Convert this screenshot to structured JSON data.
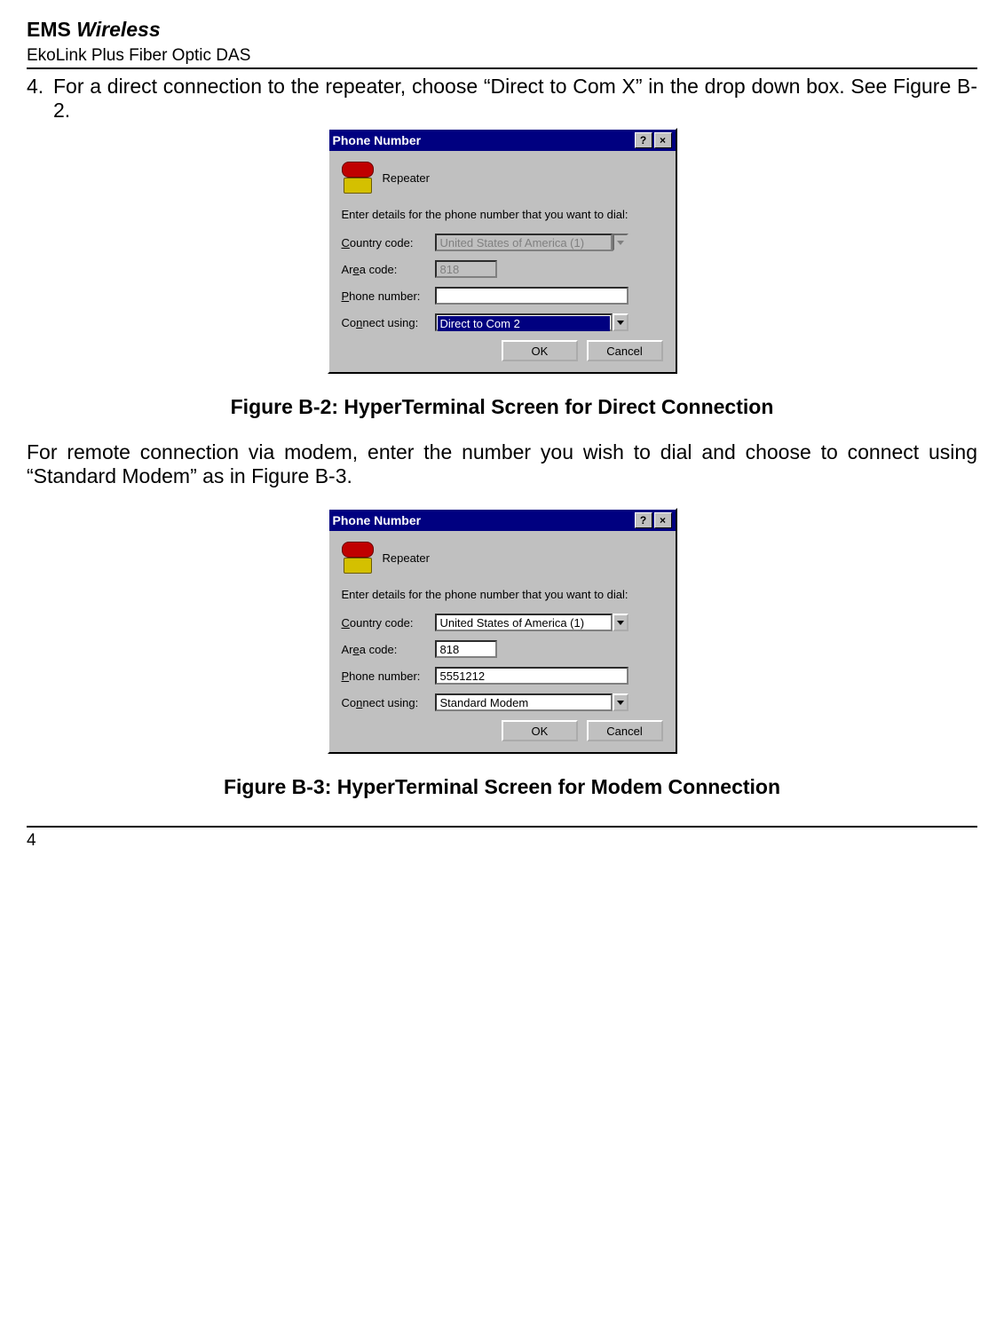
{
  "header": {
    "brand_prefix": "EMS ",
    "brand_italic": "Wireless",
    "product": "EkoLink Plus Fiber Optic DAS"
  },
  "step4": {
    "num": "4.",
    "text": "For a direct connection to the repeater, choose “Direct to Com X” in the drop down box. See Figure B-2."
  },
  "dlg1": {
    "title": "Phone Number",
    "help_glyph": "?",
    "close_glyph": "×",
    "icon_label": "Repeater",
    "prompt": "Enter details for the phone number that you want to dial:",
    "country_label_pre": "C",
    "country_label_rest": "ountry code:",
    "country_value": "United States of America (1)",
    "area_label_pre": "Ar",
    "area_label_rest": "a code:",
    "area_label_ul": "e",
    "area_value": "818",
    "phone_label_pre": "P",
    "phone_label_rest": "hone number:",
    "phone_value": "",
    "connect_label_pre": "Co",
    "connect_label_ul": "n",
    "connect_label_rest": "nect using:",
    "connect_value": "Direct to Com 2",
    "ok": "OK",
    "cancel": "Cancel"
  },
  "caption1": "Figure B-2:  HyperTerminal Screen for Direct Connection",
  "para_modem": "For remote connection via modem, enter the number you wish to dial and choose to connect using “Standard Modem” as in Figure B-3.",
  "dlg2": {
    "title": "Phone Number",
    "help_glyph": "?",
    "close_glyph": "×",
    "icon_label": "Repeater",
    "prompt": "Enter details for the phone number that you want to dial:",
    "country_value": "United States of America (1)",
    "area_value": "818",
    "phone_value": "5551212",
    "connect_value": "Standard Modem",
    "ok": "OK",
    "cancel": "Cancel"
  },
  "caption2": "Figure B-3: HyperTerminal Screen for Modem Connection",
  "page_num": "4"
}
